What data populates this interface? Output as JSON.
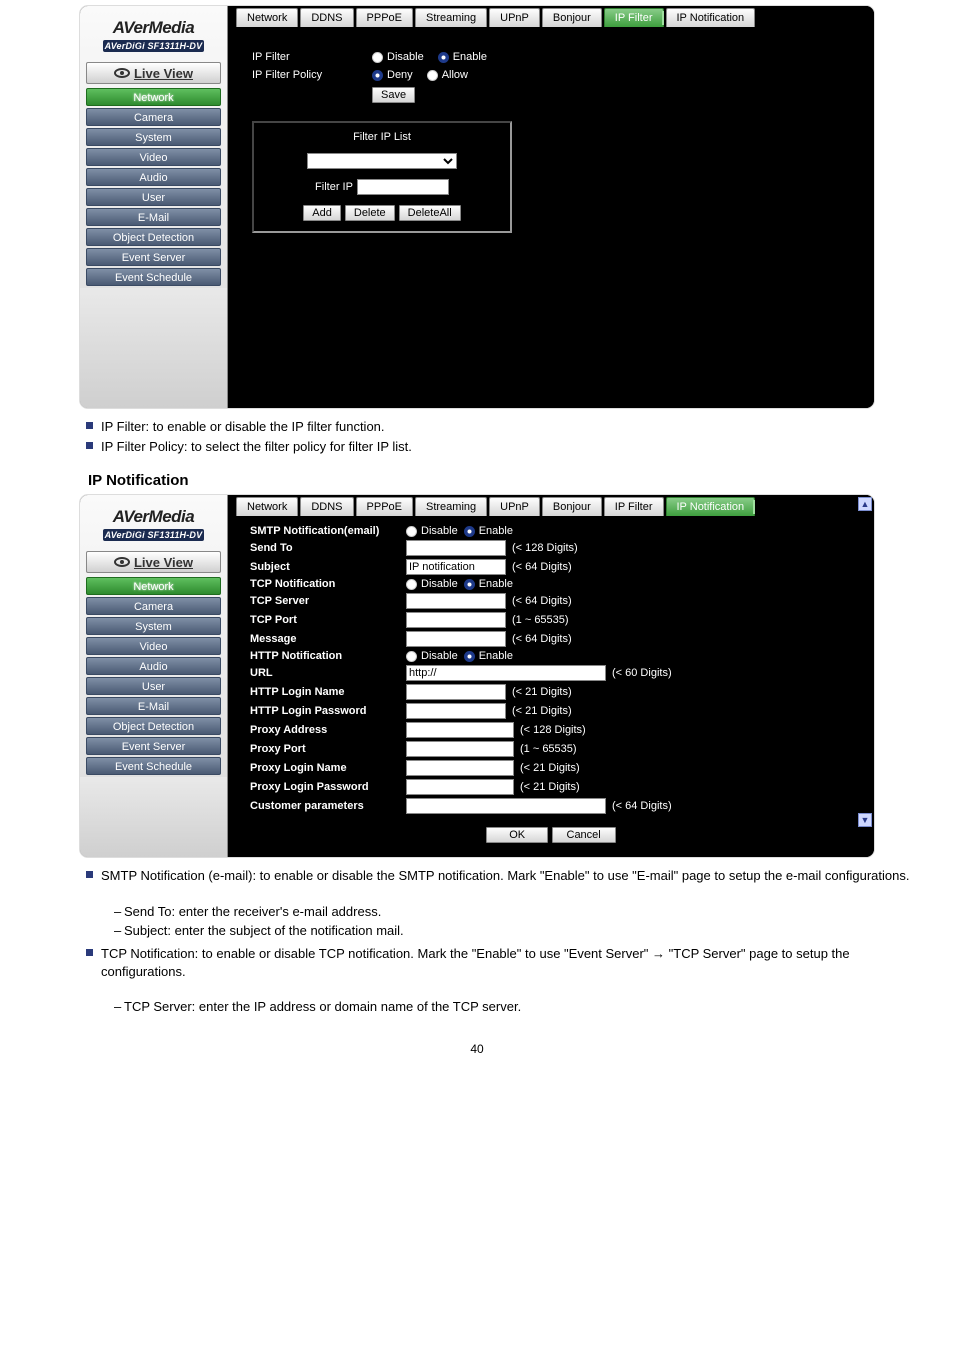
{
  "brand": {
    "main": "AVerMedia",
    "sub": "AVerDiGi SF1311H-DV"
  },
  "live_view_label": "Live View",
  "sidebar_items": [
    "Network",
    "Camera",
    "System",
    "Video",
    "Audio",
    "User",
    "E-Mail",
    "Object Detection",
    "Event Server",
    "Event Schedule"
  ],
  "tabs": [
    "Network",
    "DDNS",
    "PPPoE",
    "Streaming",
    "UPnP",
    "Bonjour",
    "IP Filter",
    "IP Notification"
  ],
  "shot1": {
    "active_tab_index": 6,
    "ipfilter": {
      "row1_label": "IP Filter",
      "row1_opt1": "Disable",
      "row1_opt2": "Enable",
      "row2_label": "IP Filter Policy",
      "row2_opt1": "Deny",
      "row2_opt2": "Allow",
      "save": "Save",
      "box_title": "Filter IP List",
      "filterip_label": "Filter IP",
      "add": "Add",
      "delete": "Delete",
      "deleteall": "DeleteAll"
    }
  },
  "desc1_b1": "IP Filter: to enable or disable the IP filter function.",
  "desc1_b2": "IP Filter Policy: to select the filter policy for filter IP list.",
  "heading": "IP Notification",
  "shot2": {
    "active_tab_index": 7,
    "rows": {
      "smtp_label": "SMTP Notification(email)",
      "smtp_disable": "Disable",
      "smtp_enable": "Enable",
      "sendto_label": "Send To",
      "sendto_hint": "(< 128 Digits)",
      "subject_label": "Subject",
      "subject_value": "IP notification",
      "subject_hint": "(< 64 Digits)",
      "tcpnotif_label": "TCP Notification",
      "tcp_disable": "Disable",
      "tcp_enable": "Enable",
      "tcpserver_label": "TCP Server",
      "tcpserver_hint": "(< 64 Digits)",
      "tcpport_label": "TCP Port",
      "tcpport_hint": "(1 ~ 65535)",
      "message_label": "Message",
      "message_hint": "(< 64 Digits)",
      "httpnotif_label": "HTTP Notification",
      "http_disable": "Disable",
      "http_enable": "Enable",
      "url_label": "URL",
      "url_value": "http://",
      "url_hint": "(< 60 Digits)",
      "httplogin_label": "HTTP Login Name",
      "httplogin_hint": "(< 21 Digits)",
      "httppw_label": "HTTP Login Password",
      "httppw_hint": "(< 21 Digits)",
      "proxyaddr_label": "Proxy Address",
      "proxyaddr_hint": "(< 128 Digits)",
      "proxyport_label": "Proxy Port",
      "proxyport_hint": "(1 ~ 65535)",
      "proxylogin_label": "Proxy Login Name",
      "proxylogin_hint": "(< 21 Digits)",
      "proxypw_label": "Proxy Login Password",
      "proxypw_hint": "(< 21 Digits)",
      "custparam_label": "Customer parameters",
      "custparam_hint": "(< 64 Digits)",
      "ok": "OK",
      "cancel": "Cancel"
    }
  },
  "desc2_b1": "SMTP Notification (e-mail): to enable or disable the SMTP notification. Mark \"Enable\" to use \"E-mail\" page to setup the e-mail configurations.",
  "desc2_s1": "Send To: enter the receiver's e-mail address.",
  "desc2_s2": "Subject: enter the subject of the notification mail.",
  "desc2_b2": "TCP Notification: to enable or disable TCP notification. Mark the \"Enable\" to use \"Event Server\" → \"TCP Server\" page to setup the configurations.",
  "desc2_s3": "TCP Server: enter the IP address or domain name of the TCP server.",
  "page_number": "40"
}
